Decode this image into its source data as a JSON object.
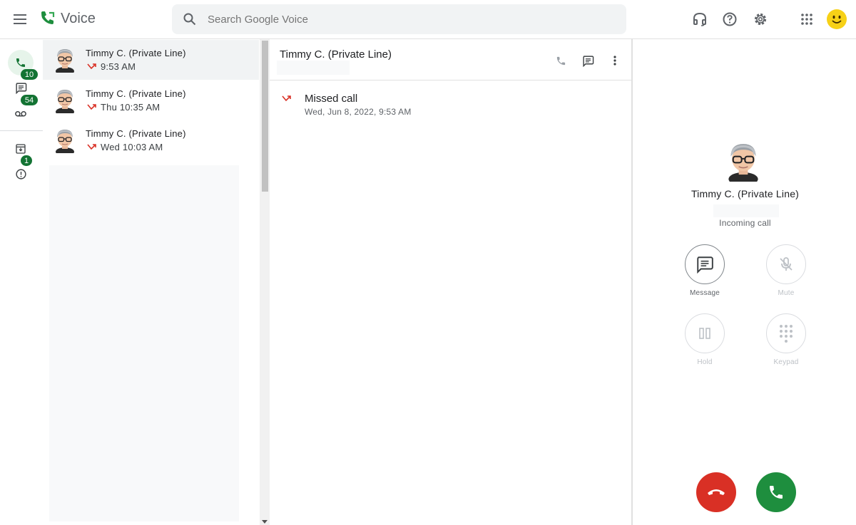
{
  "app": {
    "title": "Voice",
    "search_placeholder": "Search Google Voice"
  },
  "nav": {
    "items": [
      {
        "name": "calls",
        "icon": "phone-icon",
        "active": true,
        "badge": ""
      },
      {
        "name": "messages",
        "icon": "message-icon",
        "badge": "10"
      },
      {
        "name": "voicemail",
        "icon": "voicemail-icon",
        "badge": "54"
      },
      {
        "name": "archive",
        "icon": "archive-icon",
        "badge": ""
      },
      {
        "name": "spam",
        "icon": "spam-icon",
        "badge": "1"
      }
    ]
  },
  "list": {
    "items": [
      {
        "name": "Timmy C. (Private Line)",
        "time": "9:53 AM",
        "status": "missed",
        "selected": true
      },
      {
        "name": "Timmy C. (Private Line)",
        "time": "Thu 10:35 AM",
        "status": "missed",
        "selected": false
      },
      {
        "name": "Timmy C. (Private Line)",
        "time": "Wed 10:03 AM",
        "status": "missed",
        "selected": false
      }
    ]
  },
  "detail": {
    "title": "Timmy C. (Private Line)",
    "event": {
      "title": "Missed call",
      "date": "Wed, Jun 8, 2022, 9:53 AM"
    }
  },
  "call": {
    "caller_name": "Timmy C. (Private Line)",
    "status": "Incoming call",
    "controls": [
      {
        "label": "Message",
        "enabled": true
      },
      {
        "label": "Mute",
        "enabled": false
      },
      {
        "label": "Hold",
        "enabled": false
      },
      {
        "label": "Keypad",
        "enabled": false
      }
    ]
  },
  "colors": {
    "accent": "#1e8e3e",
    "badge": "#137333",
    "decline": "#d93025",
    "missed": "#d93025"
  }
}
